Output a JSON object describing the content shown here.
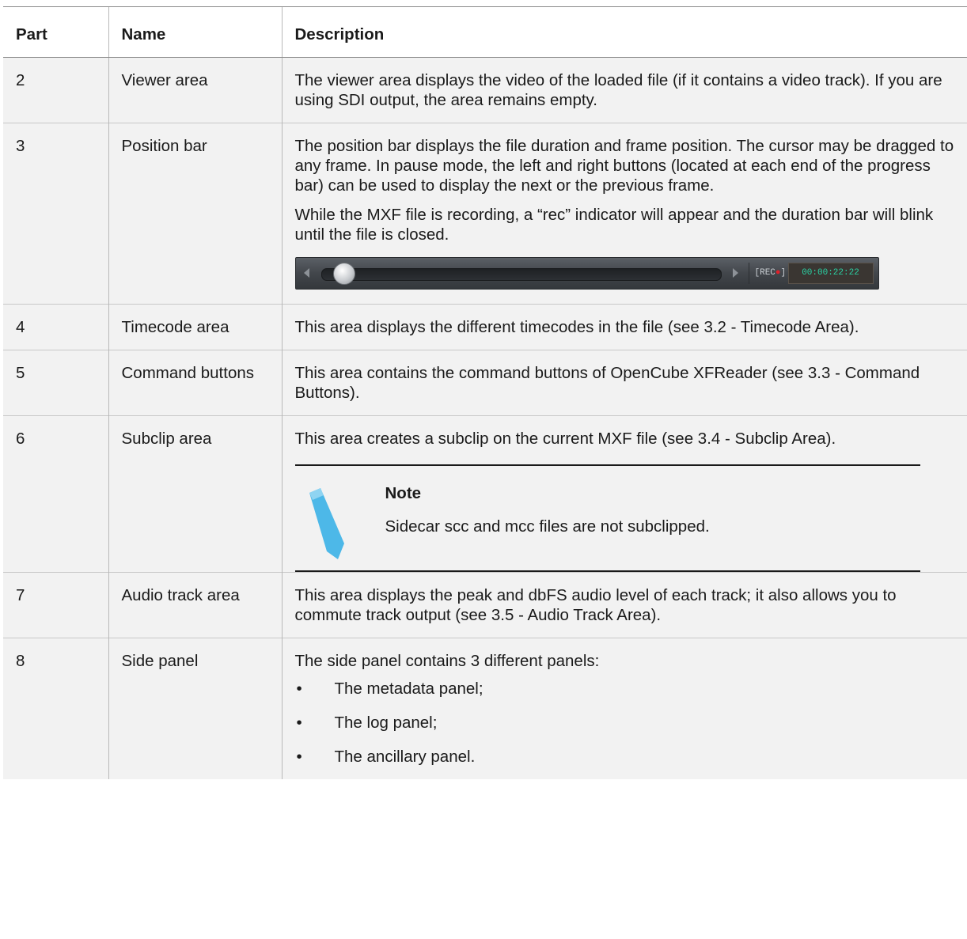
{
  "table": {
    "headers": {
      "part": "Part",
      "name": "Name",
      "description": "Description"
    },
    "rows": [
      {
        "part": "2",
        "name": "Viewer area",
        "desc": [
          "The viewer area displays the video of the loaded file (if it contains a video track). If you are using SDI output, the area remains empty."
        ]
      },
      {
        "part": "3",
        "name": "Position bar",
        "desc": [
          "The position bar displays the file duration and frame position. The cursor may be dragged to any frame. In pause mode, the left and right buttons (located at each end of the progress bar) can be used to display the next or the previous frame.",
          "While the MXF file is recording, a “rec” indicator will appear and the duration bar will blink until the file is closed."
        ]
      },
      {
        "part": "4",
        "name": "Timecode area",
        "desc": [
          "This area displays the different timecodes in the file (see 3.2 - Timecode Area)."
        ]
      },
      {
        "part": "5",
        "name": "Command buttons",
        "desc": [
          "This area contains the command buttons of OpenCube XFReader (see 3.3 - Command Buttons)."
        ]
      },
      {
        "part": "6",
        "name": "Subclip area",
        "desc": [
          "This area creates a subclip on the current MXF file (see 3.4 - Subclip Area)."
        ]
      },
      {
        "part": "7",
        "name": "Audio track area",
        "desc": [
          "This area displays the peak and dbFS audio level of each track; it also allows you to commute track output (see 3.5 - Audio Track Area)."
        ]
      },
      {
        "part": "8",
        "name": "Side panel",
        "desc": [
          "The side panel contains 3 different panels:"
        ],
        "bullets": [
          "The metadata panel;",
          "The log panel;",
          "The ancillary panel."
        ]
      }
    ]
  },
  "position_bar_image": {
    "rec_label": "[REC",
    "rec_dot": "●",
    "rec_close": "]",
    "timecode": "00:00:22:22",
    "progress": 0.02
  },
  "note": {
    "title": "Note",
    "text": "Sidecar scc and mcc files are not subclipped.",
    "icon": "pencil-icon"
  },
  "colors": {
    "row_bg": "#f2f2f2",
    "timecode_text": "#2ad2a4",
    "pencil": "#4db8e8"
  }
}
